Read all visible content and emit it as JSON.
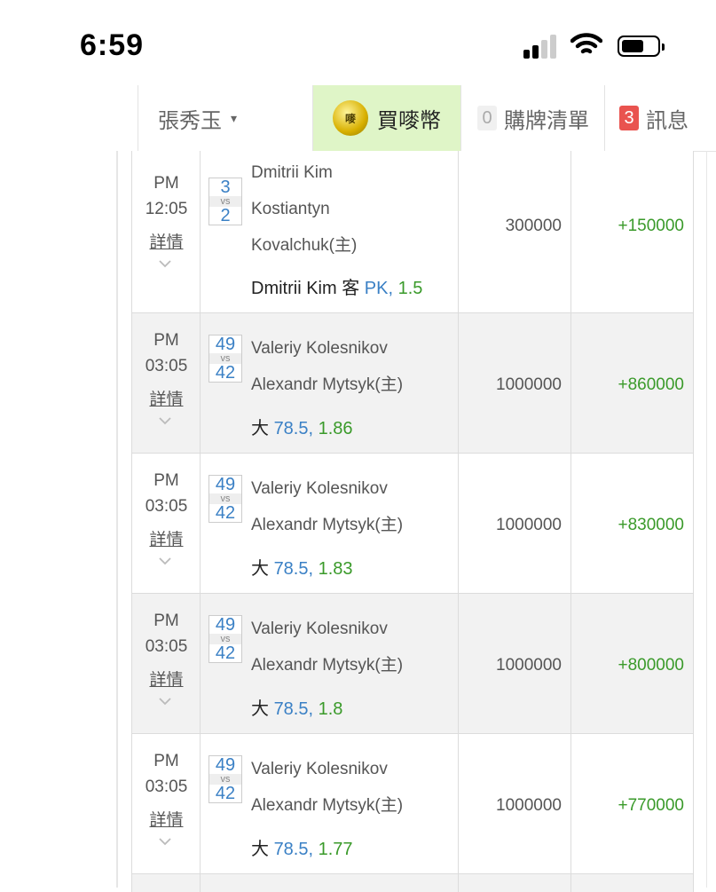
{
  "status_bar": {
    "time": "6:59"
  },
  "nav": {
    "user_name": "張秀玉",
    "caret": "▾",
    "buy_label": "買嘜幣",
    "coin_text": "嘜",
    "cart_count": "0",
    "cart_label": "購牌清單",
    "msg_count": "3",
    "msg_label": "訊息"
  },
  "rows": [
    {
      "ampm": "PM",
      "time": "12:05",
      "detail": "詳情",
      "score_a": "3",
      "vs": "vs",
      "score_b": "2",
      "team_lines": [
        "Dmitrii Kim",
        "Kostiantyn",
        "Kovalchuk(主)"
      ],
      "bet_prefix": "Dmitrii Kim 客 ",
      "bet_line": "PK,",
      "bet_odds": " 1.5",
      "amount": "300000",
      "win": "+150000"
    },
    {
      "ampm": "PM",
      "time": "03:05",
      "detail": "詳情",
      "score_a": "49",
      "vs": "vs",
      "score_b": "42",
      "team_lines": [
        "Valeriy Kolesnikov",
        "Alexandr Mytsyk(主)"
      ],
      "bet_prefix": "大 ",
      "bet_line": "78.5,",
      "bet_odds": " 1.86",
      "amount": "1000000",
      "win": "+860000"
    },
    {
      "ampm": "PM",
      "time": "03:05",
      "detail": "詳情",
      "score_a": "49",
      "vs": "vs",
      "score_b": "42",
      "team_lines": [
        "Valeriy Kolesnikov",
        "Alexandr Mytsyk(主)"
      ],
      "bet_prefix": "大 ",
      "bet_line": "78.5,",
      "bet_odds": " 1.83",
      "amount": "1000000",
      "win": "+830000"
    },
    {
      "ampm": "PM",
      "time": "03:05",
      "detail": "詳情",
      "score_a": "49",
      "vs": "vs",
      "score_b": "42",
      "team_lines": [
        "Valeriy Kolesnikov",
        "Alexandr Mytsyk(主)"
      ],
      "bet_prefix": "大 ",
      "bet_line": "78.5,",
      "bet_odds": " 1.8",
      "amount": "1000000",
      "win": "+800000"
    },
    {
      "ampm": "PM",
      "time": "03:05",
      "detail": "詳情",
      "score_a": "49",
      "vs": "vs",
      "score_b": "42",
      "team_lines": [
        "Valeriy Kolesnikov",
        "Alexandr Mytsyk(主)"
      ],
      "bet_prefix": "大 ",
      "bet_line": "78.5,",
      "bet_odds": " 1.77",
      "amount": "1000000",
      "win": "+770000"
    }
  ]
}
